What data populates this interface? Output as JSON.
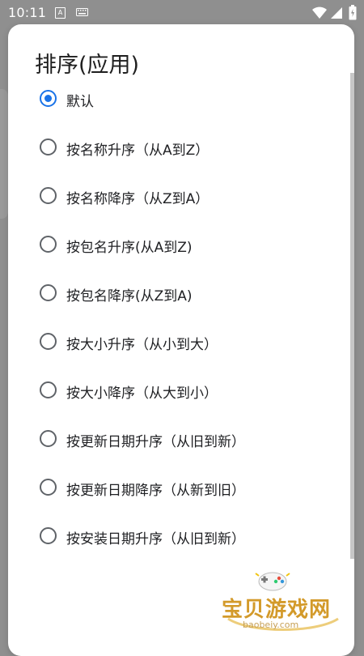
{
  "status_bar": {
    "time": "10:11",
    "a_label": "A",
    "icons": [
      "a-icon",
      "keyboard-icon",
      "wifi-icon",
      "signal-icon",
      "battery-icon"
    ]
  },
  "dialog": {
    "title": "排序(应用)",
    "options": [
      {
        "label": "默认",
        "checked": true
      },
      {
        "label": "按名称升序（从A到Z）",
        "checked": false
      },
      {
        "label": "按名称降序（从Z到A）",
        "checked": false
      },
      {
        "label": "按包名升序(从A到Z)",
        "checked": false
      },
      {
        "label": "按包名降序(从Z到A)",
        "checked": false
      },
      {
        "label": "按大小升序（从小到大）",
        "checked": false
      },
      {
        "label": "按大小降序（从大到小）",
        "checked": false
      },
      {
        "label": "按更新日期升序（从旧到新）",
        "checked": false
      },
      {
        "label": "按更新日期降序（从新到旧）",
        "checked": false
      },
      {
        "label": "按安装日期升序（从旧到新）",
        "checked": false
      }
    ]
  },
  "watermark": {
    "title": "宝贝游戏网",
    "url": "baobeiy.com"
  },
  "colors": {
    "accent": "#1a73e8",
    "scrim": "#8f8f8f",
    "surface": "#ffffff",
    "radio_unchecked": "#5f6368"
  }
}
